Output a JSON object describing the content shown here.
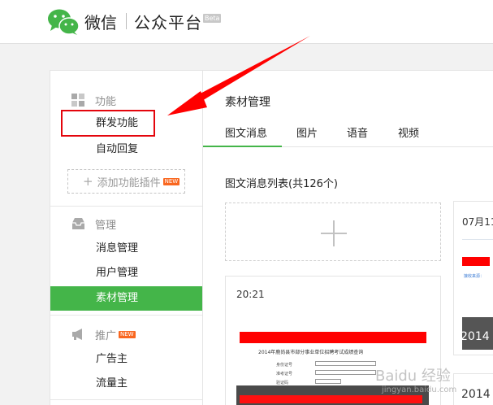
{
  "header": {
    "brand": "微信",
    "platform": "公众平台",
    "beta": "Beta"
  },
  "sidebar": {
    "features": {
      "title": "功能",
      "items": [
        "群发功能",
        "自动回复"
      ],
      "add_plugin": "添加功能插件",
      "add_plugin_badge": "NEW"
    },
    "manage": {
      "title": "管理",
      "items": [
        "消息管理",
        "用户管理",
        "素材管理"
      ],
      "active": "素材管理"
    },
    "promote": {
      "title": "推广",
      "badge": "NEW",
      "items": [
        "广告主",
        "流量主"
      ]
    }
  },
  "content": {
    "title": "素材管理",
    "tabs": [
      "图文消息",
      "图片",
      "语音",
      "视频"
    ],
    "active_tab": "图文消息",
    "list_title": "图文消息列表(共126个)",
    "cards": [
      {
        "time": "20:21",
        "doc_title": "2014年鹿尚县市部分事业单位招聘考试成绩查询",
        "doc_fields": [
          "身份证号",
          "准考证号",
          "验证码"
        ]
      },
      {
        "time": "07月11",
        "snippet": "接收来源：",
        "year": "2014"
      },
      {
        "year": "2014"
      }
    ]
  },
  "watermark": {
    "text": "Baidu 经验",
    "url": "jingyan.baidu.com"
  },
  "colors": {
    "accent": "#44b549",
    "highlight": "#e4050c",
    "badge": "#f96720"
  }
}
